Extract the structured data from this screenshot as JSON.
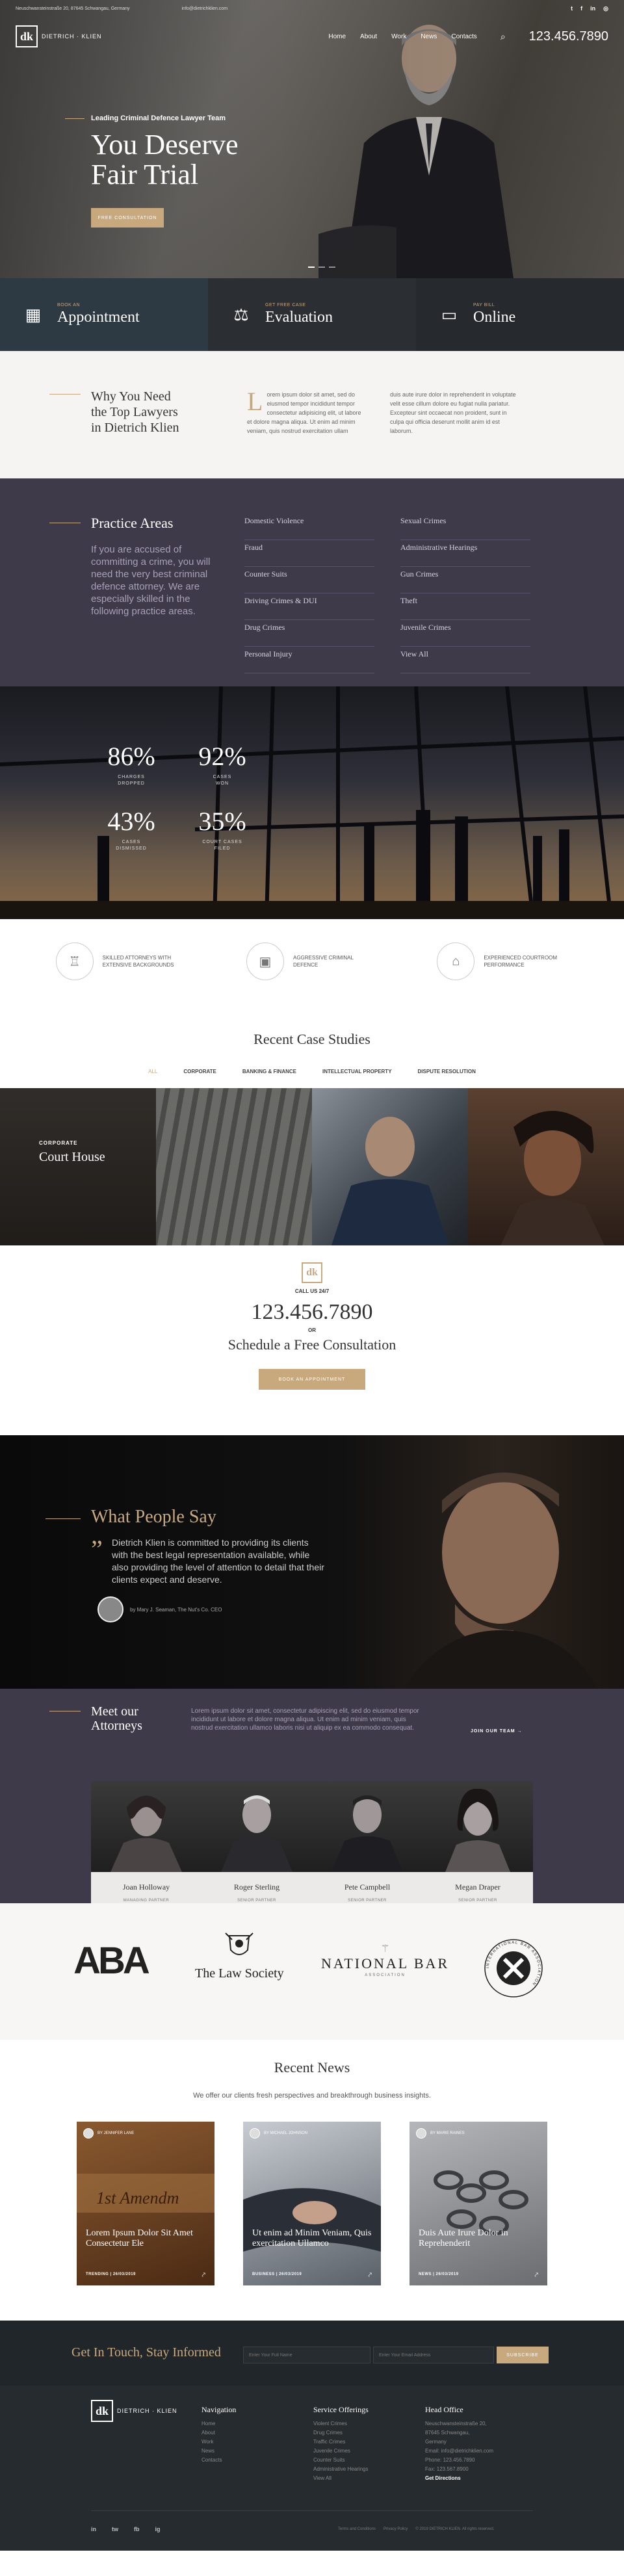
{
  "topbar": {
    "address": "Neuschwansteinstraße 20, 87645 Schwangau, Germany",
    "email": "info@dietrichklien.com",
    "social": [
      "twitter-icon",
      "facebook-icon",
      "linkedin-icon",
      "instagram-icon"
    ]
  },
  "brand": {
    "mark": "dk",
    "name": "DIETRICH · KLIEN"
  },
  "nav": {
    "items": [
      "Home",
      "About",
      "Work",
      "News",
      "Contacts"
    ],
    "phone": "123.456.7890"
  },
  "hero": {
    "kicker": "Leading Criminal Defence Lawyer Team",
    "title_line1": "You Deserve",
    "title_line2": "Fair Trial",
    "cta": "FREE CONSULTATION"
  },
  "features": [
    {
      "icon": "calendar-icon",
      "small": "BOOK AN",
      "big": "Appointment"
    },
    {
      "icon": "scales-icon",
      "small": "GET FREE CASE",
      "big": "Evaluation"
    },
    {
      "icon": "card-icon",
      "small": "PAY BILL",
      "big": "Online"
    }
  ],
  "why": {
    "title_line1": "Why You Need",
    "title_line2": "the Top Lawyers",
    "title_line3": "in Dietrich  Klien",
    "dropcap": "L",
    "col1": "orem ipsum dolor sit amet, sed do eiusmod tempor incididunt tempor consectetur adipisicing elit, ut labore et dolore magna aliqua. Ut enim ad minim veniam, quis nostrud exercitation ullam",
    "col2": "duis aute irure dolor in reprehenderit in voluptate velit esse cillum dolore eu fugiat nulla pariatur. Excepteur sint occaecat non proident, sunt in culpa qui officia deserunt mollit anim id est laborum."
  },
  "practice": {
    "title": "Practice Areas",
    "desc": "If you are accused of committing a crime, you will need the very best criminal defence attorney. We are especially skilled in the following practice areas.",
    "items": [
      "Domestic Violence",
      "Sexual Crimes",
      "Fraud",
      "Administrative Hearings",
      "Counter Suits",
      "Gun Crimes",
      "Driving Crimes & DUI",
      "Theft",
      "Drug Crimes",
      "Juvenile Crimes",
      "Personal Injury",
      "View All"
    ]
  },
  "stats": [
    {
      "num": "86%",
      "label1": "CHARGES",
      "label2": "DROPPED"
    },
    {
      "num": "92%",
      "label1": "CASES",
      "label2": "WON"
    },
    {
      "num": "43%",
      "label1": "CASES",
      "label2": "DISMISSED"
    },
    {
      "num": "35%",
      "label1": "COURT CASES",
      "label2": "FILED"
    }
  ],
  "badges": [
    {
      "icon": "trophy-icon",
      "text": "SKILLED ATTORNEYS WITH EXTENSIVE BACKGROUNDS"
    },
    {
      "icon": "briefcase-icon",
      "text": "AGGRESSIVE CRIMINAL DEFENCE"
    },
    {
      "icon": "courthouse-icon",
      "text": "EXPERIENCED COURTROOM PERFORMANCE"
    }
  ],
  "cases": {
    "title": "Recent Case Studies",
    "filters": [
      "ALL",
      "CORPORATE",
      "BANKING & FINANCE",
      "INTELLECTUAL PROPERTY",
      "DISPUTE RESOLUTION"
    ],
    "tile_label": "CORPORATE",
    "tile_title": "Court House"
  },
  "call": {
    "mark": "dk",
    "label": "CALL US 24/7",
    "phone": "123.456.7890",
    "or": "OR",
    "title": "Schedule a Free Consultation",
    "button": "BOOK AN APPOINTMENT"
  },
  "testimonial": {
    "title": "What People Say",
    "quote": "Dietrich Klien is committed to providing its clients with the best legal representation available, while also providing the level of attention to detail that their clients expect and deserve.",
    "author": "by Mary J. Seaman, The Nut's Co. CEO"
  },
  "attorneys": {
    "title_line1": "Meet our",
    "title_line2": "Attorneys",
    "desc": "Lorem ipsum dolor sit amet, consectetur adipiscing elit, sed do eiusmod tempor incididunt ut labore et dolore magna aliqua. Ut enim ad minim veniam, quis nostrud exercitation ullamco laboris nisi ut aliquip ex ea commodo consequat.",
    "team_link": "JOIN OUR TEAM  →",
    "people": [
      {
        "name": "Joan Holloway",
        "role": "MANAGING PARTNER"
      },
      {
        "name": "Roger Sterling",
        "role": "SENIOR PARTNER"
      },
      {
        "name": "Pete Campbell",
        "role": "SENIOR PARTNER"
      },
      {
        "name": "Megan Draper",
        "role": "SENIOR PARTNER"
      }
    ]
  },
  "logos": {
    "aba": "ABA",
    "law_society": "The Law Society",
    "national_bar": "NATIONAL BAR",
    "national_bar_sub": "ASSOCIATION",
    "iba": "INTERNATIONAL BAR ASSOCIATION"
  },
  "news": {
    "title": "Recent  News",
    "subtitle": "We offer our clients fresh perspectives and breakthrough business insights.",
    "cards": [
      {
        "author": "BY JENNIFER LANE",
        "title": "Lorem Ipsum Dolor Sit Amet Consectetur Ele",
        "meta": "TRENDING | 26/03/2019"
      },
      {
        "author": "BY MICHAEL JOHNSON",
        "title": "Ut enim ad Minim Veniam, Quis exercitation Ullamco",
        "meta": "BUSINESS | 26/03/2019"
      },
      {
        "author": "BY MARIE RAINES",
        "title": "Duis Aute Irure Dolor in Reprehenderit",
        "meta": "NEWS | 26/03/2019"
      }
    ]
  },
  "newsletter": {
    "title": "Get In Touch, Stay Informed",
    "name_placeholder": "Enter Your Full Name",
    "email_placeholder": "Enter Your Email Address",
    "button": "SUBSCRIBE"
  },
  "footer": {
    "navigation": {
      "title": "Navigation",
      "items": [
        "Home",
        "About",
        "Work",
        "News",
        "Contacts"
      ]
    },
    "services": {
      "title": "Service Offerings",
      "items": [
        "Violent Crimes",
        "Drug Crimes",
        "Traffic Crimes",
        "Juvenile Crimes",
        "Counter Suits",
        "Administrative Hearings",
        "View All"
      ]
    },
    "office": {
      "title": "Head Office",
      "address1": "Neuschwansteinstraße 20,",
      "address2": "87645 Schwangau,",
      "address3": "Germany",
      "email": "Email: info@dietrichklien.com",
      "phone": "Phone: 123.456.7890",
      "fax": "Fax: 123.567.8900",
      "directions": "Get Directions"
    },
    "social": [
      "in",
      "tw",
      "fb",
      "ig"
    ],
    "legal": [
      "Terms and Conditions",
      "Privacy Policy",
      "© 2019 DIETRICH KLIEN. All rights reserved."
    ]
  }
}
